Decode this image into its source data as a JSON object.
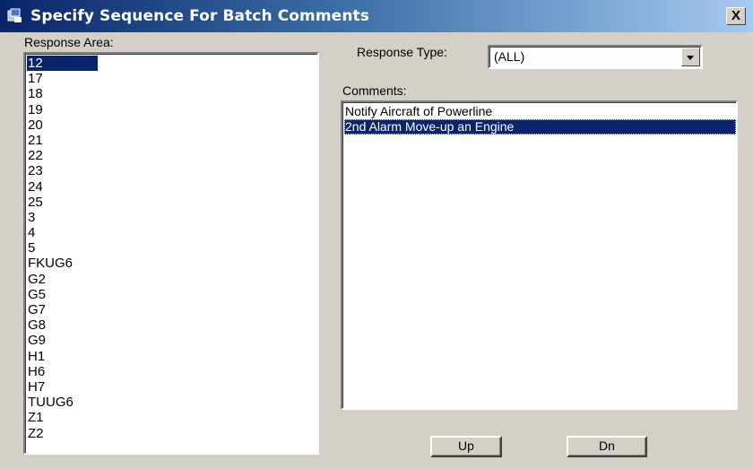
{
  "window": {
    "title": "Specify Sequence For Batch Comments",
    "close_glyph": "X"
  },
  "response_area": {
    "label": "Response Area:",
    "items": [
      "12",
      "17",
      "18",
      "19",
      "20",
      "21",
      "22",
      "23",
      "24",
      "25",
      "3",
      "4",
      "5",
      "FKUG6",
      "G2",
      "G5",
      "G7",
      "G8",
      "G9",
      "H1",
      "H6",
      "H7",
      "TUUG6",
      "Z1",
      "Z2"
    ],
    "selected": "12"
  },
  "response_type": {
    "label": "Response Type:",
    "value": "(ALL)"
  },
  "comments": {
    "label": "Comments:",
    "items": [
      "Notify Aircraft of Powerline",
      "2nd Alarm Move-up an Engine"
    ],
    "selected": "2nd Alarm Move-up an Engine"
  },
  "buttons": {
    "up_label": "Up",
    "dn_label": "Dn"
  },
  "colors": {
    "selection": "#0a246a",
    "title_gradient_start": "#0a246a",
    "title_gradient_end": "#a6caf0",
    "face": "#d4d0c8"
  }
}
